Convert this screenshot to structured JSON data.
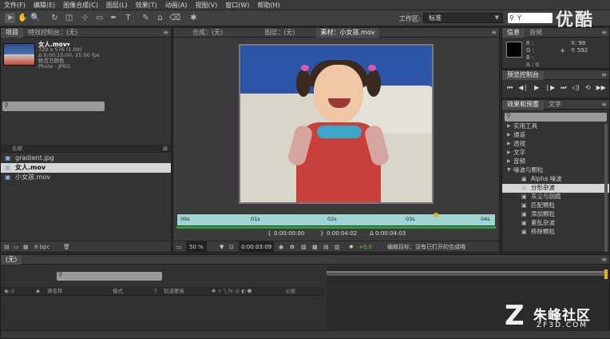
{
  "menu": [
    "文件(F)",
    "编辑(E)",
    "图像合成(C)",
    "图层(L)",
    "效果(T)",
    "动画(A)",
    "视图(V)",
    "窗口(W)",
    "帮助(H)"
  ],
  "toolbar": {
    "workspace_label": "工作区:",
    "workspace_value": "标准",
    "help_search": "Y",
    "brand": "优酷"
  },
  "project": {
    "tabs": [
      "项目",
      "特效控制台：(无)"
    ],
    "footage_name": "女人.mov▾",
    "footage_dims": "720 x 576 (1.09)",
    "footage_duration": "Δ 0;00;15;00, 25.00 fps",
    "footage_colors": "数百万颜色",
    "footage_codec": "Photo - JPEG",
    "column_name": "名称",
    "files": [
      "gradient.jpg",
      "女人.mov",
      "小女孩.mov"
    ],
    "bpc": "8 bpc"
  },
  "viewer": {
    "tabs": [
      "合成：(无)",
      "图层：(无)",
      "素材：小女孩.mov"
    ],
    "ruler_ticks": [
      "00s",
      "01s",
      "02s",
      "03s",
      "04s"
    ],
    "playhead_progress": 0.82,
    "time_current": "0:00:00:00",
    "time_out": "0:00:04:02",
    "time_duration": "Δ 0:00:04:03",
    "zoom": "50 %",
    "timecode": "0:00:03:09",
    "offset": "+0.0",
    "edit_target": "编辑目标：没有已打开的合成哦"
  },
  "info": {
    "tabs": [
      "信息",
      "音频"
    ],
    "r_label": "R :",
    "g_label": "G :",
    "b_label": "B :",
    "a_label": "A : 0",
    "x": "X: 98",
    "y": "Y: 592"
  },
  "preview": {
    "tab": "预览控制台"
  },
  "effects": {
    "tabs": [
      "效果和预置",
      "文字"
    ],
    "categories": [
      "实用工具",
      "通道",
      "透视",
      "文字",
      "音频",
      "噪波与颗粒"
    ],
    "items": [
      "Alpha 噪波",
      "分形杂波",
      "灰尘与刮痕",
      "匹配颗粒",
      "添加颗粒",
      "紊乱杂波",
      "移除颗粒"
    ],
    "selected_item": "分形杂波"
  },
  "timeline": {
    "tab": "(无)",
    "col_source": "源名称",
    "col_mode": "模式",
    "col_t": "T",
    "col_trkmat": "轨道蒙板",
    "col_parent": "父级"
  },
  "watermark": {
    "mark": "Z",
    "name": "朱峰社区",
    "url": "ZF3D.COM"
  }
}
